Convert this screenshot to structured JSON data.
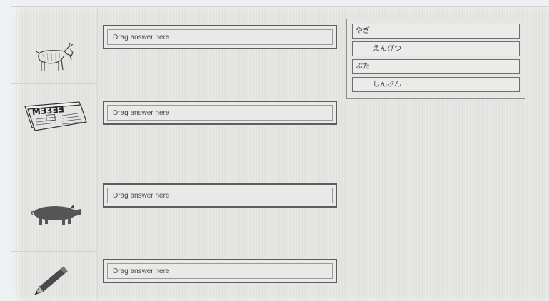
{
  "drop_zones": [
    {
      "placeholder": "Drag answer here"
    },
    {
      "placeholder": "Drag answer here"
    },
    {
      "placeholder": "Drag answer here"
    },
    {
      "placeholder": "Drag answer here"
    }
  ],
  "images": [
    {
      "icon": "goat-icon"
    },
    {
      "icon": "newspaper-icon",
      "text": "MƎ3ƎƎ"
    },
    {
      "icon": "pig-icon"
    },
    {
      "icon": "pencil-icon"
    }
  ],
  "answer_bank": {
    "tiles": [
      {
        "label": "やぎ"
      },
      {
        "label": "えんぴつ"
      },
      {
        "label": "ぶた"
      },
      {
        "label": "しんぶん"
      }
    ]
  }
}
